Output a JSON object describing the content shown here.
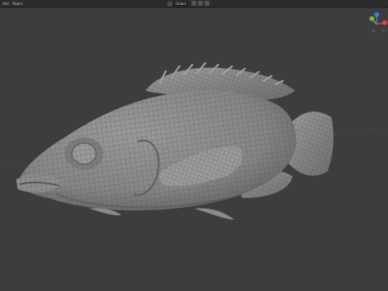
{
  "header": {
    "menu": [
      {
        "label": "Add"
      },
      {
        "label": "Object"
      }
    ],
    "orientation": {
      "value": "Global"
    }
  },
  "gizmo": {
    "axes": [
      "x-axis",
      "y-axis",
      "z-axis"
    ]
  },
  "colors": {
    "background": "#3d3d3d",
    "header": "#2b2b2b",
    "mesh": "#8a8a8a",
    "mesh_dark": "#6a6a6a",
    "wire": "#4e4e4e",
    "x_axis": "#d14848",
    "y_axis": "#7fb53a",
    "z_axis": "#3e7de0"
  },
  "viewport": {
    "object": "fish-mesh",
    "shading": "solid-wireframe"
  }
}
